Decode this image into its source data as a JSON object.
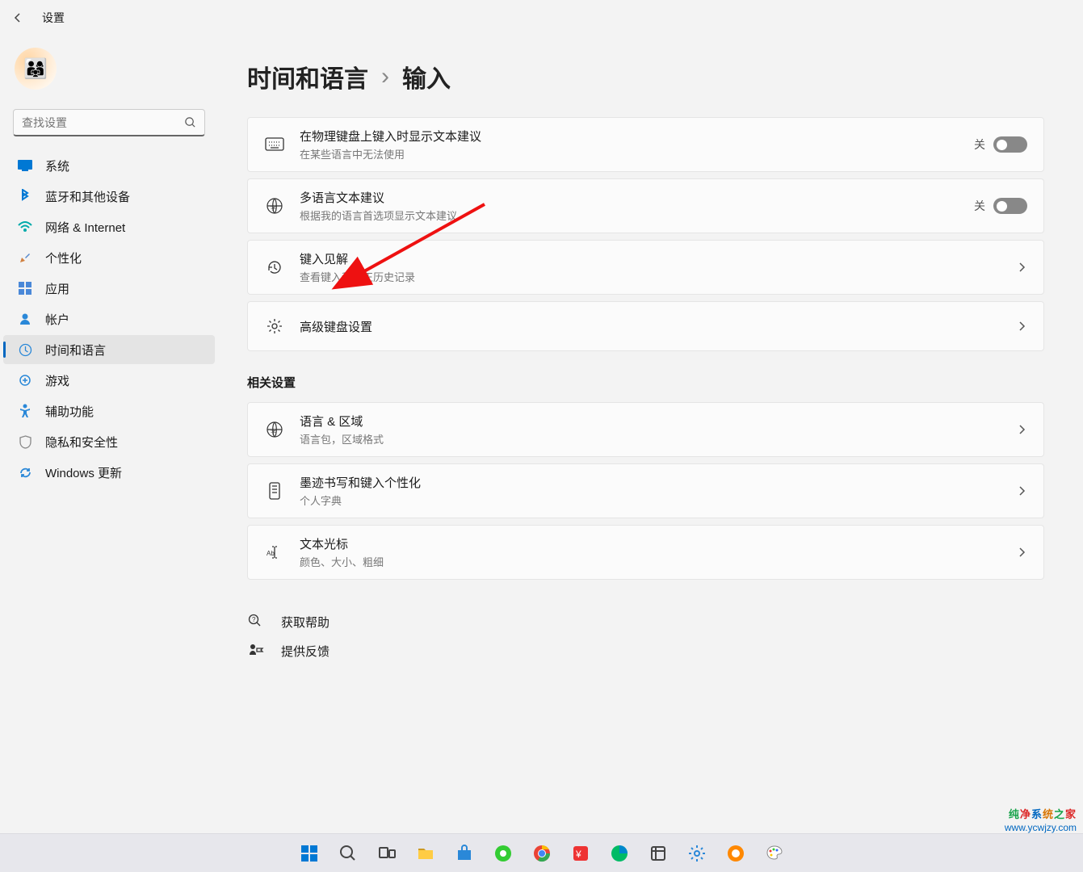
{
  "titlebar": {
    "app_title": "设置"
  },
  "sidebar": {
    "search_placeholder": "查找设置",
    "items": [
      {
        "label": "系统",
        "icon": "system",
        "active": false
      },
      {
        "label": "蓝牙和其他设备",
        "icon": "bluetooth",
        "active": false
      },
      {
        "label": "网络 & Internet",
        "icon": "network",
        "active": false
      },
      {
        "label": "个性化",
        "icon": "personalize",
        "active": false
      },
      {
        "label": "应用",
        "icon": "apps",
        "active": false
      },
      {
        "label": "帐户",
        "icon": "account",
        "active": false
      },
      {
        "label": "时间和语言",
        "icon": "time-lang",
        "active": true
      },
      {
        "label": "游戏",
        "icon": "gaming",
        "active": false
      },
      {
        "label": "辅助功能",
        "icon": "accessibility",
        "active": false
      },
      {
        "label": "隐私和安全性",
        "icon": "privacy",
        "active": false
      },
      {
        "label": "Windows 更新",
        "icon": "update",
        "active": false
      }
    ]
  },
  "breadcrumb": {
    "parent": "时间和语言",
    "current": "输入"
  },
  "settings": [
    {
      "title": "在物理键盘上键入时显示文本建议",
      "sub": "在某些语言中无法使用",
      "icon": "keyboard",
      "right": "toggle",
      "toggle_state": "关"
    },
    {
      "title": "多语言文本建议",
      "sub": "根据我的语言首选项显示文本建议",
      "icon": "multilang",
      "right": "toggle",
      "toggle_state": "关"
    },
    {
      "title": "键入见解",
      "sub": "查看键入和更正历史记录",
      "icon": "history",
      "right": "chevron"
    },
    {
      "title": "高级键盘设置",
      "sub": "",
      "icon": "gear",
      "right": "chevron"
    }
  ],
  "related_header": "相关设置",
  "related": [
    {
      "title": "语言 & 区域",
      "sub": "语言包，区域格式",
      "icon": "globe",
      "right": "chevron"
    },
    {
      "title": "墨迹书写和键入个性化",
      "sub": "个人字典",
      "icon": "ink",
      "right": "chevron"
    },
    {
      "title": "文本光标",
      "sub": "颜色、大小、粗细",
      "icon": "cursor",
      "right": "chevron"
    }
  ],
  "help": [
    {
      "label": "获取帮助",
      "icon": "help"
    },
    {
      "label": "提供反馈",
      "icon": "feedback"
    }
  ],
  "taskbar": {
    "icons": [
      "start",
      "search",
      "taskview",
      "explorer",
      "store",
      "chrome-green",
      "chrome",
      "baidu",
      "edge",
      "crop",
      "settings",
      "browser-360",
      "paint"
    ]
  },
  "watermark": {
    "line1": "纯净系统之家",
    "line2": "www.ycwjzy.com"
  }
}
